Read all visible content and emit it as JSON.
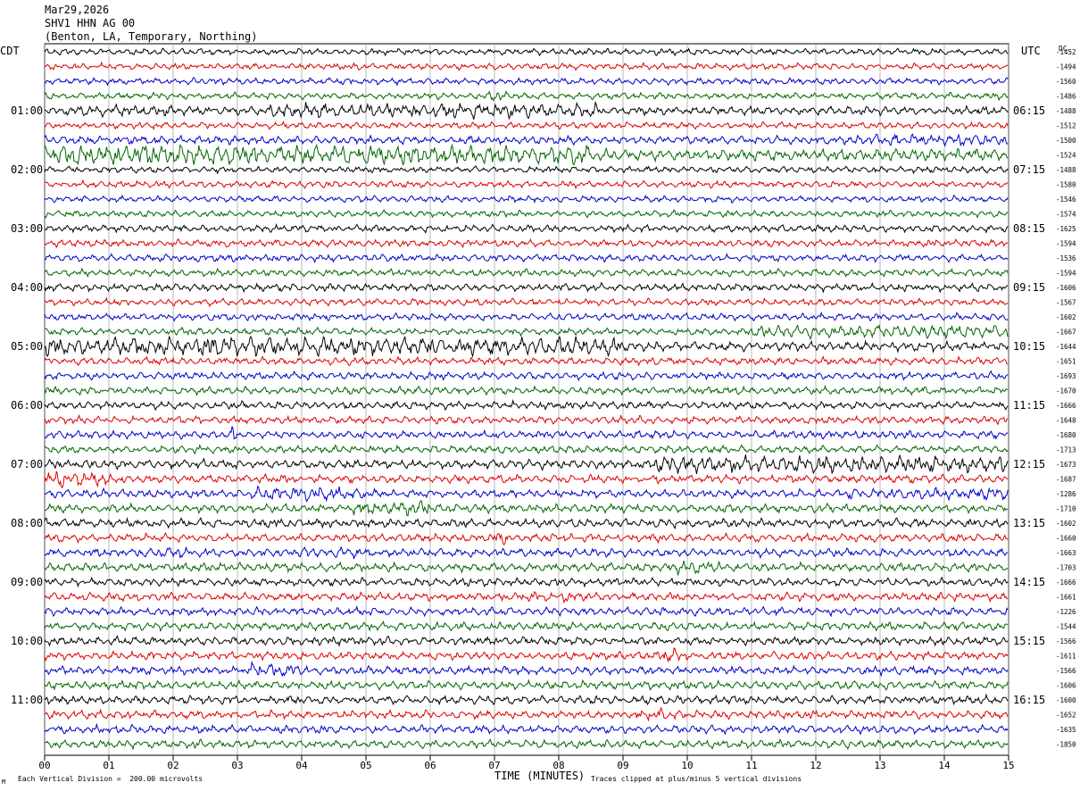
{
  "header": {
    "date": "Mar29,2026",
    "station": "SHV1 HHN AG 00",
    "location": "(Benton, LA, Temporary, Northing)"
  },
  "axes": {
    "left_timezone": "CDT",
    "right_timezone": "UTC",
    "dc_label": "DC",
    "xlabel": "TIME (MINUTES)",
    "scale_note": "Each Vertical Division =  200.00 microvolts",
    "clip_note": "Traces clipped at plus/minus 5 vertical divisions",
    "corner_mark": "M"
  },
  "chart_data": {
    "type": "line",
    "subtype": "helicorder",
    "xlim": [
      0,
      15
    ],
    "x_ticks": [
      "00",
      "01",
      "02",
      "03",
      "04",
      "05",
      "06",
      "07",
      "08",
      "09",
      "10",
      "11",
      "12",
      "13",
      "14",
      "15"
    ],
    "trace_colors": [
      "#000000",
      "#e00000",
      "#0000cc",
      "#006600"
    ],
    "left_hour_labels": [
      {
        "row": 4,
        "label": "01:00"
      },
      {
        "row": 8,
        "label": "02:00"
      },
      {
        "row": 12,
        "label": "03:00"
      },
      {
        "row": 16,
        "label": "04:00"
      },
      {
        "row": 20,
        "label": "05:00"
      },
      {
        "row": 24,
        "label": "06:00"
      },
      {
        "row": 28,
        "label": "07:00"
      },
      {
        "row": 32,
        "label": "08:00"
      },
      {
        "row": 36,
        "label": "09:00"
      },
      {
        "row": 40,
        "label": "10:00"
      },
      {
        "row": 44,
        "label": "11:00"
      }
    ],
    "right_hour_labels": [
      {
        "row": 4,
        "label": "06:15"
      },
      {
        "row": 8,
        "label": "07:15"
      },
      {
        "row": 12,
        "label": "08:15"
      },
      {
        "row": 16,
        "label": "09:15"
      },
      {
        "row": 20,
        "label": "10:15"
      },
      {
        "row": 24,
        "label": "11:15"
      },
      {
        "row": 28,
        "label": "12:15"
      },
      {
        "row": 32,
        "label": "13:15"
      },
      {
        "row": 36,
        "label": "14:15"
      },
      {
        "row": 40,
        "label": "15:15"
      },
      {
        "row": 44,
        "label": "16:15"
      }
    ],
    "dc_values": [
      "-1452",
      "-1494",
      "-1560",
      "-1486",
      "-1488",
      "-1512",
      "-1500",
      "-1524",
      "-1488",
      "-1580",
      "-1546",
      "-1574",
      "-1625",
      "-1594",
      "-1536",
      "-1594",
      "-1606",
      "-1567",
      "-1602",
      "-1667",
      "-1644",
      "-1651",
      "-1693",
      "-1670",
      "-1666",
      "-1648",
      "-1680",
      "-1713",
      "-1673",
      "-1687",
      "-1286",
      "-1710",
      "-1602",
      "-1660",
      "-1663",
      "-1703",
      "-1666",
      "-1661",
      "-1226",
      "-1544",
      "-1566",
      "-1611",
      "-1566",
      "-1606",
      "-1600",
      "-1652",
      "-1635",
      "-1850"
    ],
    "rows": [
      {
        "amp": 0.55,
        "bursts": []
      },
      {
        "amp": 0.55,
        "bursts": []
      },
      {
        "amp": 0.55,
        "bursts": []
      },
      {
        "amp": 0.55,
        "bursts": [
          [
            6.8,
            7.3,
            1.6
          ]
        ]
      },
      {
        "amp": 0.7,
        "bursts": [
          [
            3.5,
            8.6,
            1.8
          ],
          [
            0.3,
            2.0,
            1.3
          ]
        ]
      },
      {
        "amp": 0.55,
        "bursts": []
      },
      {
        "amp": 0.7,
        "bursts": [
          [
            12.5,
            15.0,
            1.5
          ]
        ]
      },
      {
        "amp": 1.0,
        "bursts": [
          [
            0.0,
            8.5,
            1.8
          ]
        ]
      },
      {
        "amp": 0.55,
        "bursts": []
      },
      {
        "amp": 0.55,
        "bursts": []
      },
      {
        "amp": 0.55,
        "bursts": []
      },
      {
        "amp": 0.55,
        "bursts": []
      },
      {
        "amp": 0.6,
        "bursts": []
      },
      {
        "amp": 0.6,
        "bursts": []
      },
      {
        "amp": 0.6,
        "bursts": []
      },
      {
        "amp": 0.6,
        "bursts": []
      },
      {
        "amp": 0.65,
        "bursts": []
      },
      {
        "amp": 0.6,
        "bursts": []
      },
      {
        "amp": 0.6,
        "bursts": []
      },
      {
        "amp": 0.6,
        "bursts": [
          [
            11.0,
            15.0,
            1.8
          ]
        ]
      },
      {
        "amp": 0.8,
        "bursts": [
          [
            0.0,
            9.0,
            2.0
          ]
        ]
      },
      {
        "amp": 0.65,
        "bursts": []
      },
      {
        "amp": 0.65,
        "bursts": []
      },
      {
        "amp": 0.65,
        "bursts": []
      },
      {
        "amp": 0.65,
        "bursts": []
      },
      {
        "amp": 0.65,
        "bursts": []
      },
      {
        "amp": 0.65,
        "bursts": [
          [
            2.9,
            3.0,
            3.5
          ]
        ]
      },
      {
        "amp": 0.65,
        "bursts": []
      },
      {
        "amp": 0.8,
        "bursts": [
          [
            9.5,
            15.0,
            1.8
          ]
        ]
      },
      {
        "amp": 0.7,
        "bursts": [
          [
            0.0,
            1.0,
            2.0
          ]
        ]
      },
      {
        "amp": 0.7,
        "bursts": [
          [
            3.2,
            5.0,
            1.6
          ],
          [
            12.5,
            15.0,
            1.5
          ]
        ]
      },
      {
        "amp": 0.7,
        "bursts": [
          [
            4.8,
            6.0,
            1.8
          ]
        ]
      },
      {
        "amp": 0.75,
        "bursts": []
      },
      {
        "amp": 0.7,
        "bursts": [
          [
            6.9,
            7.2,
            1.6
          ]
        ]
      },
      {
        "amp": 0.7,
        "bursts": [
          [
            1.5,
            2.2,
            1.4
          ],
          [
            4.0,
            5.0,
            1.4
          ]
        ]
      },
      {
        "amp": 0.75,
        "bursts": [
          [
            9.8,
            10.5,
            1.6
          ]
        ]
      },
      {
        "amp": 0.7,
        "bursts": []
      },
      {
        "amp": 0.7,
        "bursts": [
          [
            7.5,
            8.5,
            1.3
          ]
        ]
      },
      {
        "amp": 0.7,
        "bursts": []
      },
      {
        "amp": 0.7,
        "bursts": []
      },
      {
        "amp": 0.7,
        "bursts": []
      },
      {
        "amp": 0.7,
        "bursts": [
          [
            9.6,
            9.9,
            1.8
          ]
        ]
      },
      {
        "amp": 0.7,
        "bursts": [
          [
            3.2,
            4.2,
            1.8
          ]
        ]
      },
      {
        "amp": 0.7,
        "bursts": []
      },
      {
        "amp": 0.7,
        "bursts": []
      },
      {
        "amp": 0.7,
        "bursts": [
          [
            9.2,
            10.0,
            1.4
          ]
        ]
      },
      {
        "amp": 0.7,
        "bursts": []
      },
      {
        "amp": 0.7,
        "bursts": []
      }
    ]
  }
}
